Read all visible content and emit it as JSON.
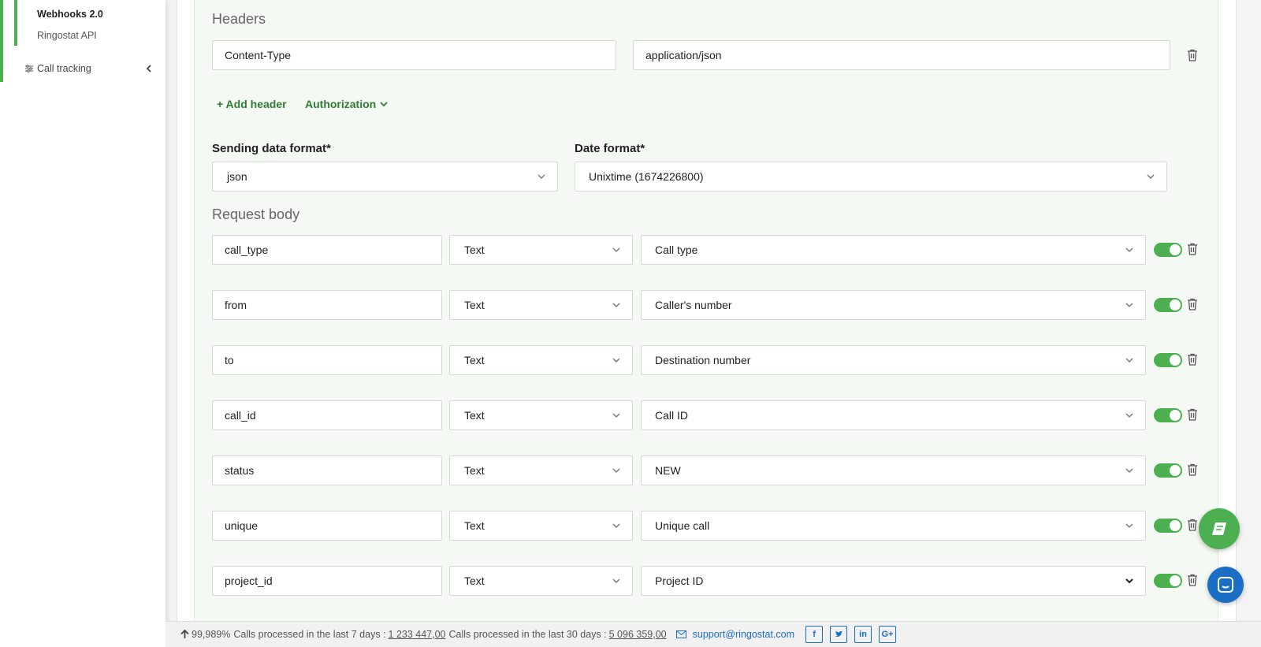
{
  "sidebar": {
    "sub_items": [
      "Webhooks 2.0",
      "Ringostat API"
    ],
    "nav_item": "Call tracking"
  },
  "headers": {
    "title": "Headers",
    "name_value": "Content-Type",
    "value_value": "application/json",
    "add_header_label": "+ Add header",
    "authorization_label": "Authorization"
  },
  "formats": {
    "sending_label": "Sending data format*",
    "sending_value": "json",
    "date_label": "Date format*",
    "date_value": "Unixtime (1674226800)"
  },
  "request_body": {
    "title": "Request body",
    "rows": [
      {
        "key": "call_type",
        "type": "Text",
        "value": "Call type",
        "enabled": true
      },
      {
        "key": "from",
        "type": "Text",
        "value": "Caller's number",
        "enabled": true
      },
      {
        "key": "to",
        "type": "Text",
        "value": "Destination number",
        "enabled": true
      },
      {
        "key": "call_id",
        "type": "Text",
        "value": "Call ID",
        "enabled": true
      },
      {
        "key": "status",
        "type": "Text",
        "value": "NEW",
        "enabled": true
      },
      {
        "key": "unique",
        "type": "Text",
        "value": "Unique call",
        "enabled": true
      },
      {
        "key": "project_id",
        "type": "Text",
        "value": "Project ID",
        "enabled": true
      }
    ]
  },
  "footer": {
    "uptime": "99,989%",
    "calls7_label": "Calls processed in the last 7 days :",
    "calls7_value": "1 233 447,00",
    "calls30_label": "Calls processed in the last 30 days :",
    "calls30_value": "5 096 359,00",
    "email": "support@ringostat.com",
    "socials": [
      "facebook-icon",
      "twitter-icon",
      "linkedin-icon",
      "google-plus-icon"
    ]
  },
  "colors": {
    "accent": "#4caf50",
    "link": "#2e7d32",
    "blue": "#1a6fc4"
  }
}
